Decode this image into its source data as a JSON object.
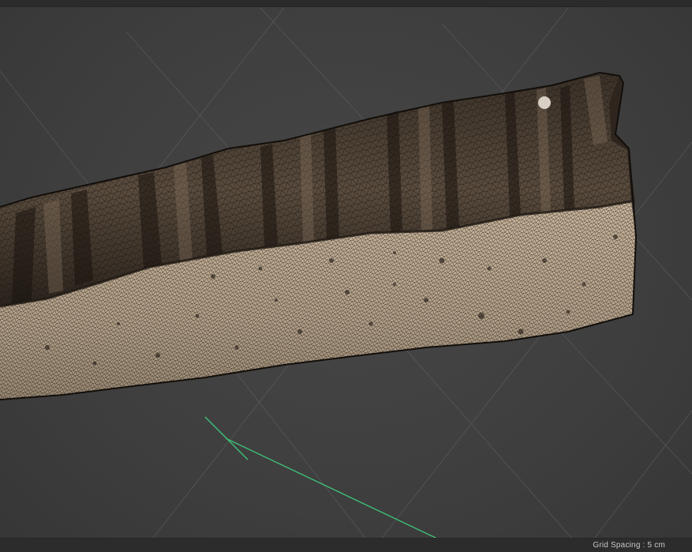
{
  "status_bar": {
    "grid_spacing_label": "Grid Spacing : 5 cm"
  },
  "viewport": {
    "mesh_color": "#b8a690",
    "wire_color": "#1a1510",
    "grid_color": "#6a6a6a",
    "axis_color": "#3fbf78"
  }
}
